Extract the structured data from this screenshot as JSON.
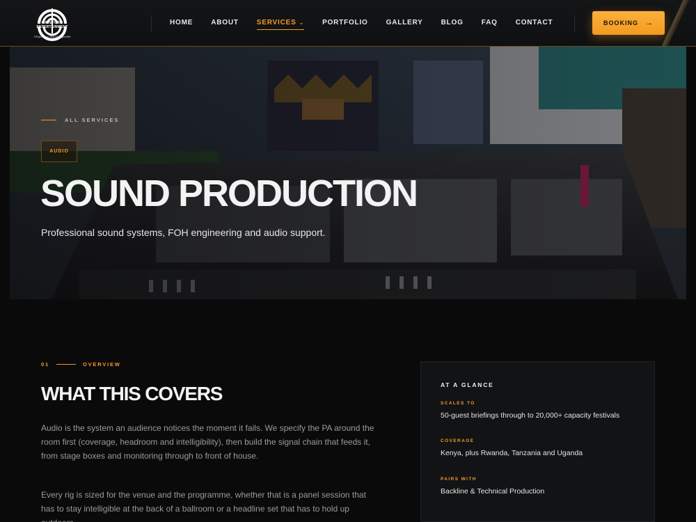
{
  "brand": {
    "logo_text": "WAVEFORM ENTERTAINMENT",
    "logo_tagline": "A Experience That Unforgettable"
  },
  "nav": {
    "items": [
      {
        "label": "HOME",
        "active": false
      },
      {
        "label": "ABOUT",
        "active": false
      },
      {
        "label": "SERVICES",
        "active": true
      },
      {
        "label": "PORTFOLIO",
        "active": false
      },
      {
        "label": "GALLERY",
        "active": false
      },
      {
        "label": "BLOG",
        "active": false
      },
      {
        "label": "FAQ",
        "active": false
      },
      {
        "label": "CONTACT",
        "active": false
      }
    ],
    "booking_label": "BOOKING"
  },
  "hero": {
    "breadcrumb": "ALL SERVICES",
    "tag": "AUDIO",
    "title": "SOUND PRODUCTION",
    "subtitle": "Professional sound systems, FOH engineering and audio support."
  },
  "overview": {
    "number": "01",
    "label": "OVERVIEW",
    "title": "WHAT THIS COVERS",
    "paragraphs": [
      "Audio is the system an audience notices the moment it fails. We specify the PA around the room first (coverage, headroom and intelligibility), then build the signal chain that feeds it, from stage boxes and monitoring through to front of house.",
      "Every rig is sized for the venue and the programme, whether that is a panel session that has to stay intelligible at the back of a ballroom or a headline set that has to hold up outdoors."
    ]
  },
  "glance": {
    "title": "AT A GLANCE",
    "items": [
      {
        "key": "SCALES TO",
        "value": "50-guest briefings through to 20,000+ capacity festivals"
      },
      {
        "key": "COVERAGE",
        "value": "Kenya, plus Rwanda, Tanzania and Uganda"
      },
      {
        "key": "PAIRS WITH",
        "value": "Backline & Technical Production"
      }
    ]
  },
  "colors": {
    "accent": "#f59a2a",
    "background": "#0a0a0b",
    "card": "#111315"
  }
}
